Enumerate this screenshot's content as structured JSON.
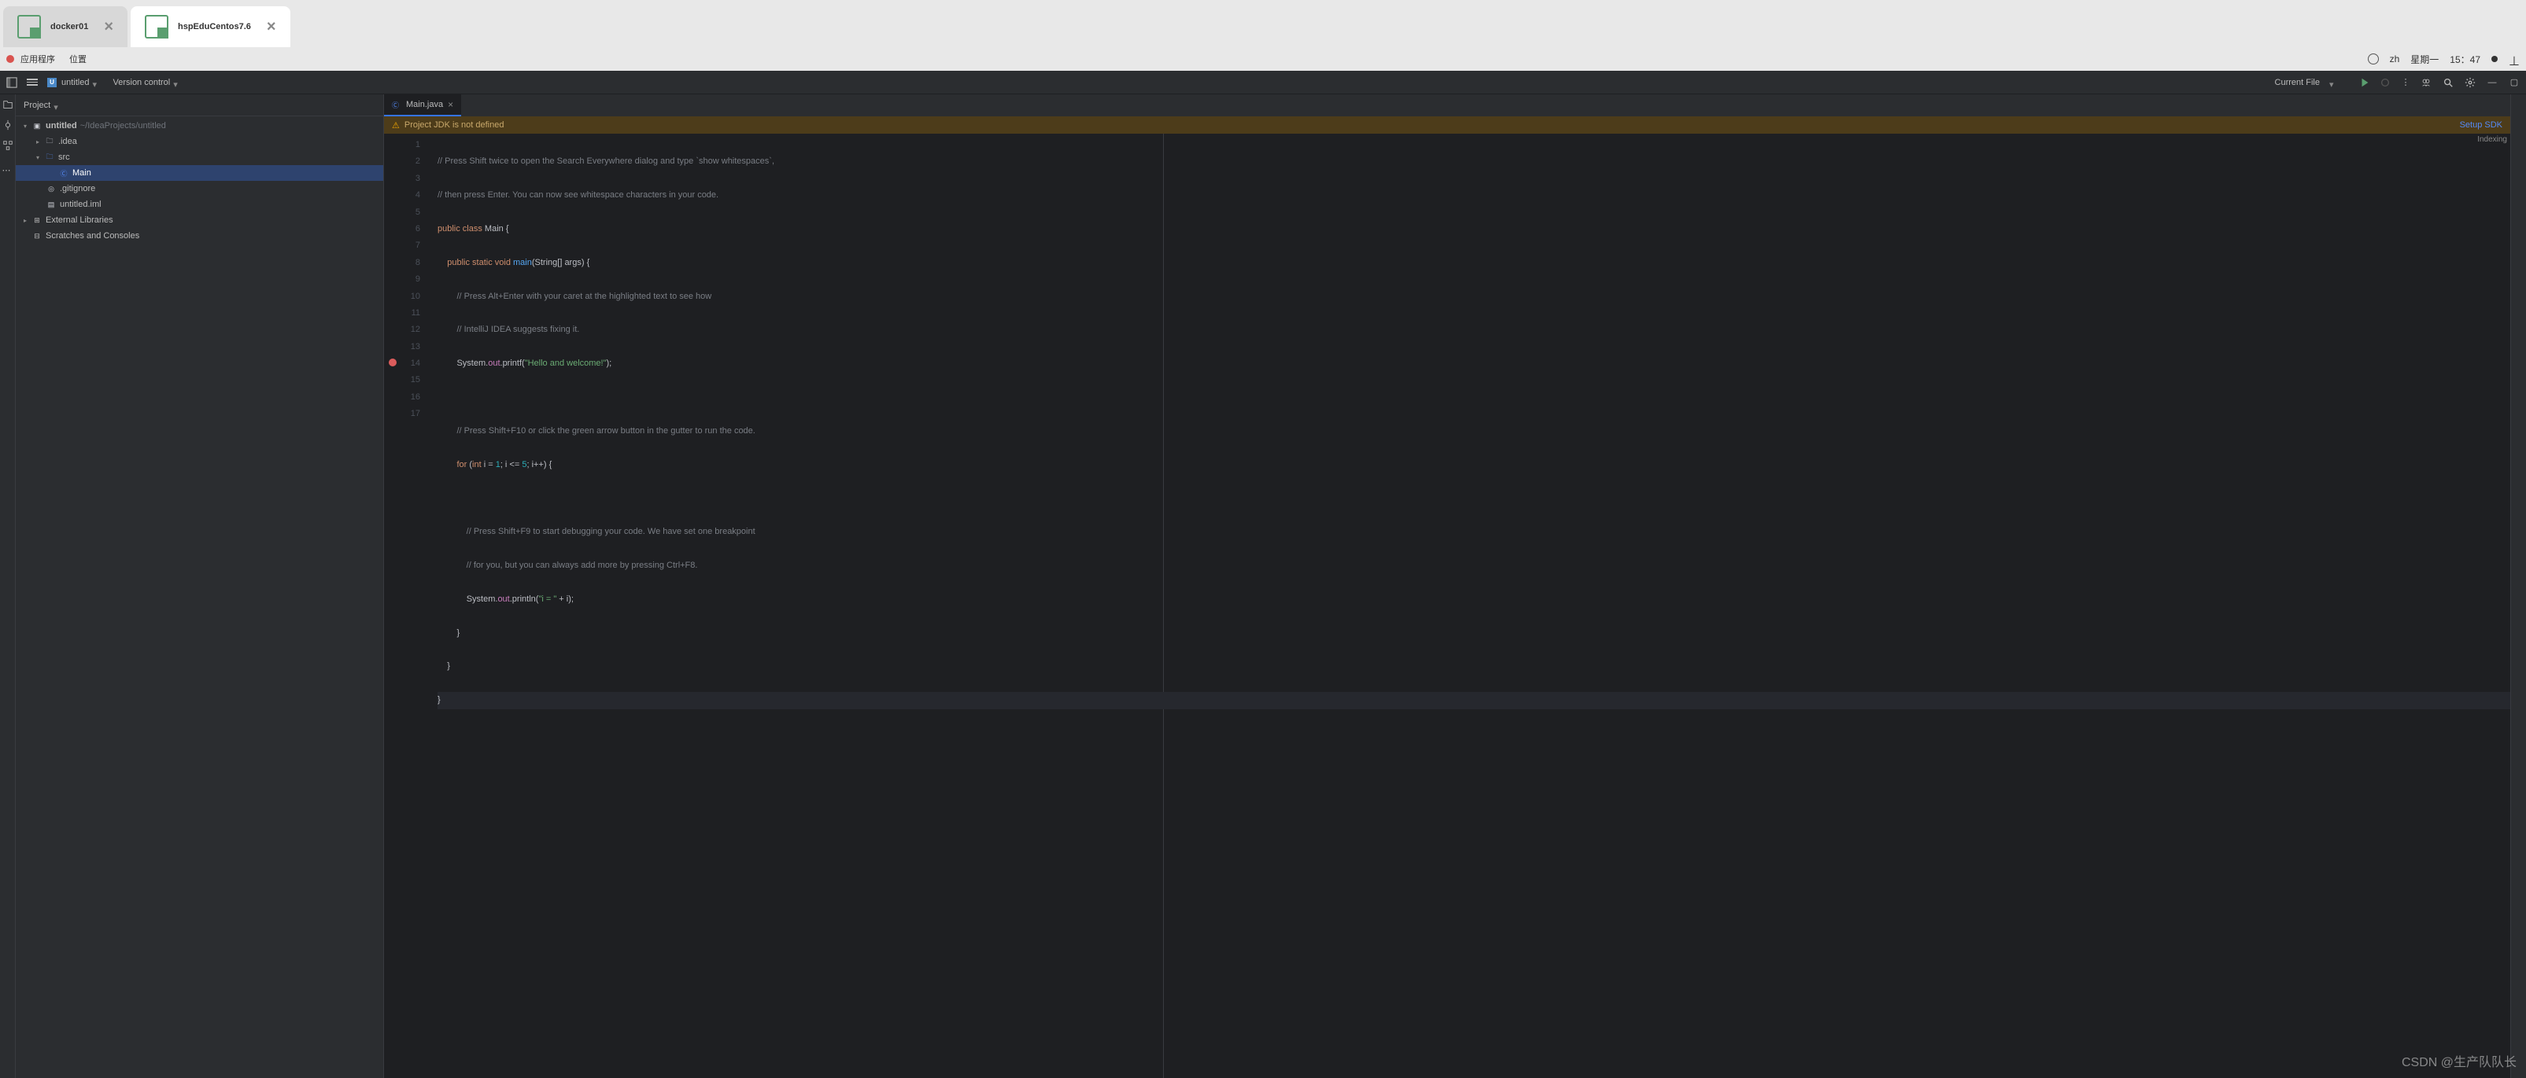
{
  "window": {
    "tabs": [
      {
        "label": "docker01",
        "active": false
      },
      {
        "label": "hspEduCentos7.6",
        "active": true
      }
    ]
  },
  "menubar": {
    "apps": "应用程序",
    "places": "位置",
    "lang": "zh",
    "day": "星期一",
    "time": "15：47"
  },
  "ide": {
    "project_name": "untitled",
    "vcs": "Version control",
    "current_file": "Current File",
    "project_panel_title": "Project"
  },
  "tree": {
    "root": "untitled",
    "root_path": "~/IdeaProjects/untitled",
    "idea": ".idea",
    "src": "src",
    "main": "Main",
    "gitignore": ".gitignore",
    "iml": "untitled.iml",
    "ext": "External Libraries",
    "scratch": "Scratches and Consoles"
  },
  "editor": {
    "tab_name": "Main.java",
    "banner_text": "Project JDK is not defined",
    "banner_link": "Setup SDK",
    "status": "Indexing"
  },
  "code": {
    "l1": "// Press Shift twice to open the Search Everywhere dialog and type `show whitespaces`,",
    "l2": "// then press Enter. You can now see whitespace characters in your code.",
    "l3a": "public class ",
    "l3b": "Main",
    "l3c": " {",
    "l4a": "    public static void ",
    "l4b": "main",
    "l4c": "(",
    "l4d": "String",
    "l4e": "[] ",
    "l4f": "args",
    "l4g": ") {",
    "l5": "        // Press Alt+Enter with your caret at the highlighted text to see how",
    "l6": "        // IntelliJ IDEA suggests fixing it.",
    "l7a": "        ",
    "l7b": "System",
    "l7c": ".",
    "l7d": "out",
    "l7e": ".",
    "l7f": "printf",
    "l7g": "(",
    "l7h": "\"Hello and welcome!\"",
    "l7i": ");",
    "l8": "",
    "l9": "        // Press Shift+F10 or click the green arrow button in the gutter to run the code.",
    "l10a": "        for ",
    "l10b": "(",
    "l10c": "int ",
    "l10d": "i = ",
    "l10e": "1",
    "l10f": "; i <= ",
    "l10g": "5",
    "l10h": "; i++) {",
    "l11": "",
    "l12": "            // Press Shift+F9 to start debugging your code. We have set one breakpoint",
    "l13": "            // for you, but you can always add more by pressing Ctrl+F8.",
    "l14a": "            ",
    "l14b": "System",
    "l14c": ".",
    "l14d": "out",
    "l14e": ".",
    "l14f": "println",
    "l14g": "(",
    "l14h": "\"i = \"",
    "l14i": " + i);",
    "l15": "        }",
    "l16": "    }",
    "l17": "}"
  },
  "watermark": "CSDN @生产队队长"
}
